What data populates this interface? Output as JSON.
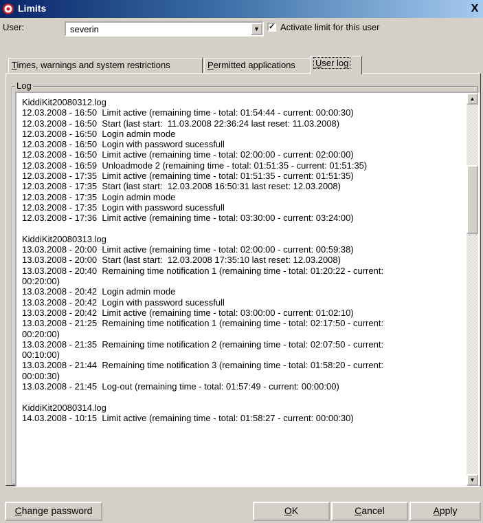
{
  "window": {
    "title": "Limits",
    "icon": "gear-icon",
    "close_label": "X"
  },
  "user": {
    "label": "User:",
    "value": "severin",
    "activate_label": "Activate limit for this user",
    "activate_checked": true
  },
  "tabs": [
    {
      "label_rest": "imes, warnings and system restrictions",
      "mnemonic": "T"
    },
    {
      "label_rest": "ermitted applications",
      "mnemonic": "P"
    },
    {
      "label_rest": "ser log",
      "mnemonic": "U",
      "active": true
    }
  ],
  "log": {
    "group_label": "Log",
    "lines": [
      "KiddiKit20080312.log",
      "12.03.2008 - 16:50  Limit active (remaining time - total: 01:54:44 - current: 00:00:30)",
      "12.03.2008 - 16:50  Start (last start:  11.03.2008 22:36:24 last reset: 11.03.2008)",
      "12.03.2008 - 16:50  Login admin mode",
      "12.03.2008 - 16:50  Login with password sucessfull",
      "12.03.2008 - 16:50  Limit active (remaining time - total: 02:00:00 - current: 02:00:00)",
      "12.03.2008 - 16:59  Unloadmode 2 (remaining time - total: 01:51:35 - current: 01:51:35)",
      "12.03.2008 - 17:35  Limit active (remaining time - total: 01:51:35 - current: 01:51:35)",
      "12.03.2008 - 17:35  Start (last start:  12.03.2008 16:50:31 last reset: 12.03.2008)",
      "12.03.2008 - 17:35  Login admin mode",
      "12.03.2008 - 17:35  Login with password sucessfull",
      "12.03.2008 - 17:36  Limit active (remaining time - total: 03:30:00 - current: 03:24:00)",
      "",
      "KiddiKit20080313.log",
      "13.03.2008 - 20:00  Limit active (remaining time - total: 02:00:00 - current: 00:59:38)",
      "13.03.2008 - 20:00  Start (last start:  12.03.2008 17:35:10 last reset: 12.03.2008)",
      "13.03.2008 - 20:40  Remaining time notification 1 (remaining time - total: 01:20:22 - current:",
      "00:20:00)",
      "13.03.2008 - 20:42  Login admin mode",
      "13.03.2008 - 20:42  Login with password sucessfull",
      "13.03.2008 - 20:42  Limit active (remaining time - total: 03:00:00 - current: 01:02:10)",
      "13.03.2008 - 21:25  Remaining time notification 1 (remaining time - total: 02:17:50 - current:",
      "00:20:00)",
      "13.03.2008 - 21:35  Remaining time notification 2 (remaining time - total: 02:07:50 - current:",
      "00:10:00)",
      "13.03.2008 - 21:44  Remaining time notification 3 (remaining time - total: 01:58:20 - current:",
      "00:00:30)",
      "13.03.2008 - 21:45  Log-out (remaining time - total: 01:57:49 - current: 00:00:00)",
      "",
      "KiddiKit20080314.log",
      "14.03.2008 - 10:15  Limit active (remaining time - total: 01:58:27 - current: 00:00:30)"
    ]
  },
  "buttons": {
    "change_password_mnemonic": "C",
    "change_password_rest": "hange password",
    "ok_mnemonic": "O",
    "ok_rest": "K",
    "cancel_mnemonic": "C",
    "cancel_rest": "ancel",
    "apply_mnemonic": "A",
    "apply_rest": "pply"
  }
}
